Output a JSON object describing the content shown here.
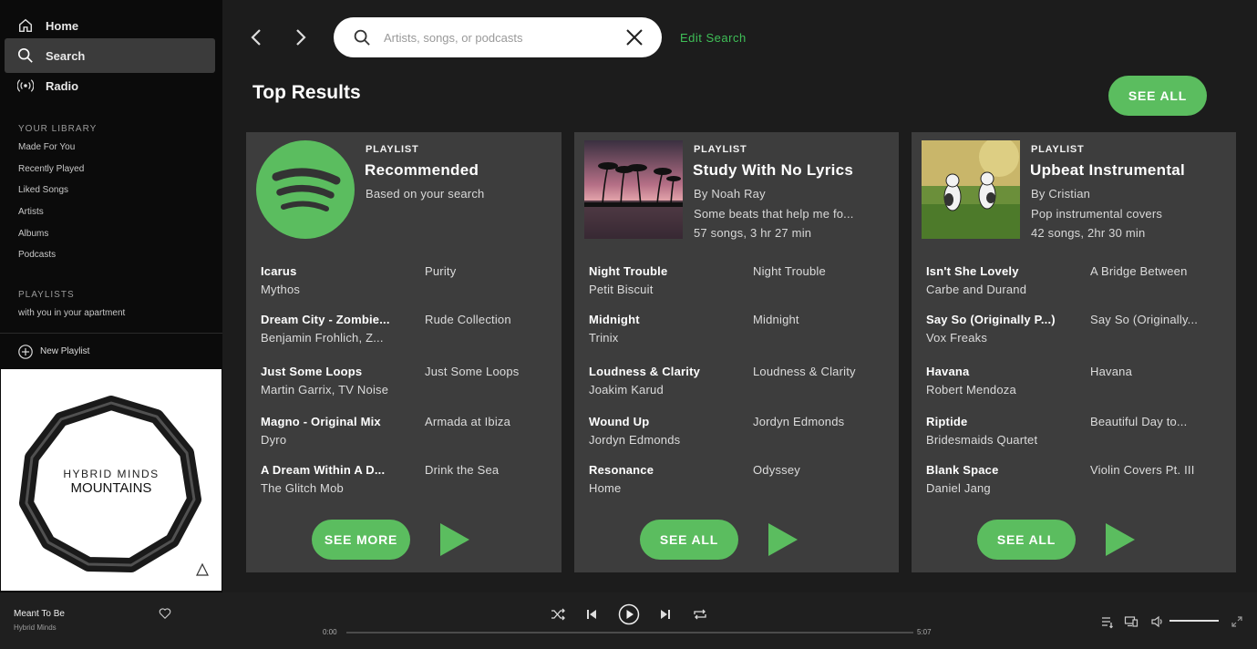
{
  "sidebar": {
    "nav": [
      {
        "label": "Home",
        "icon": "home-icon"
      },
      {
        "label": "Search",
        "icon": "search-icon",
        "active": true
      },
      {
        "label": "Radio",
        "icon": "radio-icon"
      }
    ],
    "library_title": "YOUR LIBRARY",
    "library_items": [
      "Made For You",
      "Recently Played",
      "Liked Songs",
      "Artists",
      "Albums",
      "Podcasts"
    ],
    "playlists_title": "PLAYLISTS",
    "playlists": [
      "with you in your apartment"
    ],
    "new_playlist": "New Playlist",
    "album_art": {
      "line1": "HYBRID MINDS",
      "line2": "MOUNTAINS"
    }
  },
  "topbar": {
    "search_placeholder": "Artists, songs, or podcasts",
    "search_value": "",
    "edit_search": "Edit Search"
  },
  "main": {
    "title": "Top Results",
    "see_all": "SEE ALL",
    "cards": [
      {
        "label": "PLAYLIST",
        "title": "Recommended",
        "meta": [
          "Based on your search"
        ],
        "thumb": "spotify-logo",
        "button": "SEE MORE",
        "songs": [
          {
            "title": "Icarus",
            "artist": "Mythos",
            "album": "Purity"
          },
          {
            "title": "Dream City - Zombie...",
            "artist": "Benjamin Frohlich, Z...",
            "album": "Rude Collection"
          },
          {
            "title": "Just Some Loops",
            "artist": "Martin Garrix, TV Noise",
            "album": "Just Some Loops"
          },
          {
            "title": "Magno - Original Mix",
            "artist": "Dyro",
            "album": "Armada at Ibiza"
          },
          {
            "title": "A Dream Within A D...",
            "artist": "The Glitch Mob",
            "album": "Drink the Sea"
          }
        ]
      },
      {
        "label": "PLAYLIST",
        "title": "Study With No Lyrics",
        "meta": [
          "By Noah Ray",
          "Some beats that help me fo...",
          "57 songs, 3 hr 27 min"
        ],
        "thumb": "sunset-palms",
        "button": "SEE ALL",
        "songs": [
          {
            "title": "Night Trouble",
            "artist": "Petit Biscuit",
            "album": "Night Trouble"
          },
          {
            "title": "Midnight",
            "artist": "Trinix",
            "album": "Midnight"
          },
          {
            "title": "Loudness & Clarity",
            "artist": "Joakim Karud",
            "album": "Loudness & Clarity"
          },
          {
            "title": "Wound Up",
            "artist": "Jordyn Edmonds",
            "album": "Jordyn Edmonds"
          },
          {
            "title": "Resonance",
            "artist": "Home",
            "album": "Odyssey"
          }
        ]
      },
      {
        "label": "PLAYLIST",
        "title": "Upbeat Instrumental",
        "meta": [
          "By Cristian",
          "Pop instrumental covers",
          "42 songs, 2hr 30 min"
        ],
        "thumb": "dancing-cats",
        "button": "SEE ALL",
        "songs": [
          {
            "title": "Isn't She Lovely",
            "artist": "Carbe and Durand",
            "album": "A Bridge Between"
          },
          {
            "title": "Say So (Originally P...)",
            "artist": "Vox Freaks",
            "album": "Say So (Originally..."
          },
          {
            "title": "Havana",
            "artist": "Robert Mendoza",
            "album": "Havana"
          },
          {
            "title": "Riptide",
            "artist": "Bridesmaids Quartet",
            "album": "Beautiful Day to..."
          },
          {
            "title": "Blank Space",
            "artist": "Daniel Jang",
            "album": "Violin Covers Pt. III"
          }
        ]
      }
    ]
  },
  "player": {
    "track": "Meant To Be",
    "artist": "Hybrid Minds",
    "time_current": "0:00",
    "time_total": "5:07",
    "progress": 0,
    "volume": 1.0
  },
  "colors": {
    "accent": "#5bbd5f",
    "edit_link": "#3fbf57",
    "card_bg": "#3d3d3d",
    "main_bg": "#1c1c1c"
  }
}
